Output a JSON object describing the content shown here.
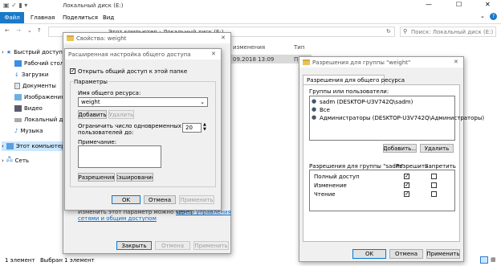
{
  "explorer": {
    "tabs": {
      "file": "Файл",
      "home": "Главная",
      "share": "Поделиться",
      "view": "Вид"
    },
    "title": "Локальный диск (E:)",
    "breadcrumb": "Этот компьютер › Локальный диск (E:)",
    "search_placeholder": "Поиск: Локальный диск (E:)",
    "columns": {
      "date": "изменения",
      "type": "Тип"
    },
    "row": {
      "date": "09.2018 13:09",
      "type": "П"
    },
    "nav": [
      "Быстрый доступ",
      "Рабочий стол",
      "Загрузки",
      "Документы",
      "Изображения",
      "Видео",
      "Локальный диск",
      "Музыка",
      "Этот компьютер",
      "Сеть"
    ],
    "status": {
      "count": "1 элемент",
      "selected": "Выбран 1 элемент"
    }
  },
  "properties": {
    "title": "Свойства: weight",
    "note": "Изменить этот параметр можно через",
    "link1": "Центр управления",
    "link2": "сетями и общим доступом",
    "close": "Закрыть",
    "cancel": "Отмена",
    "apply": "Применить"
  },
  "advanced": {
    "title": "Расширенная настройка общего доступа",
    "share_checkbox": "Открыть общий доступ к этой папке",
    "params": "Параметры",
    "share_name_label": "Имя общего ресурса:",
    "share_name": "weight",
    "add": "Добавить",
    "remove": "Удалить",
    "limit_label1": "Ограничить число одновременных",
    "limit_label2": "пользователей до:",
    "limit": "20",
    "note_label": "Примечание:",
    "permissions": "Разрешения",
    "caching": "Кэширование",
    "ok": "OK",
    "cancel": "Отмена",
    "apply": "Применить"
  },
  "perms": {
    "title": "Разрешения для группы \"weight\"",
    "tab": "Разрешения для общего ресурса",
    "group_label": "Группы или пользователи:",
    "users": [
      "sadm (DESKTOP-U3V742Q\\sadm)",
      "Все",
      "Администраторы (DESKTOP-U3V742Q\\Администраторы)"
    ],
    "add": "Добавить...",
    "remove": "Удалить",
    "table_label": "Разрешения для группы \"sadm\"",
    "allow": "Разрешить",
    "deny": "Запретить",
    "rows": [
      {
        "name": "Полный доступ",
        "allow": "✓",
        "deny": ""
      },
      {
        "name": "Изменение",
        "allow": "✓",
        "deny": ""
      },
      {
        "name": "Чтение",
        "allow": "✓",
        "deny": ""
      }
    ],
    "ok": "OK",
    "cancel": "Отмена",
    "apply": "Применить"
  }
}
